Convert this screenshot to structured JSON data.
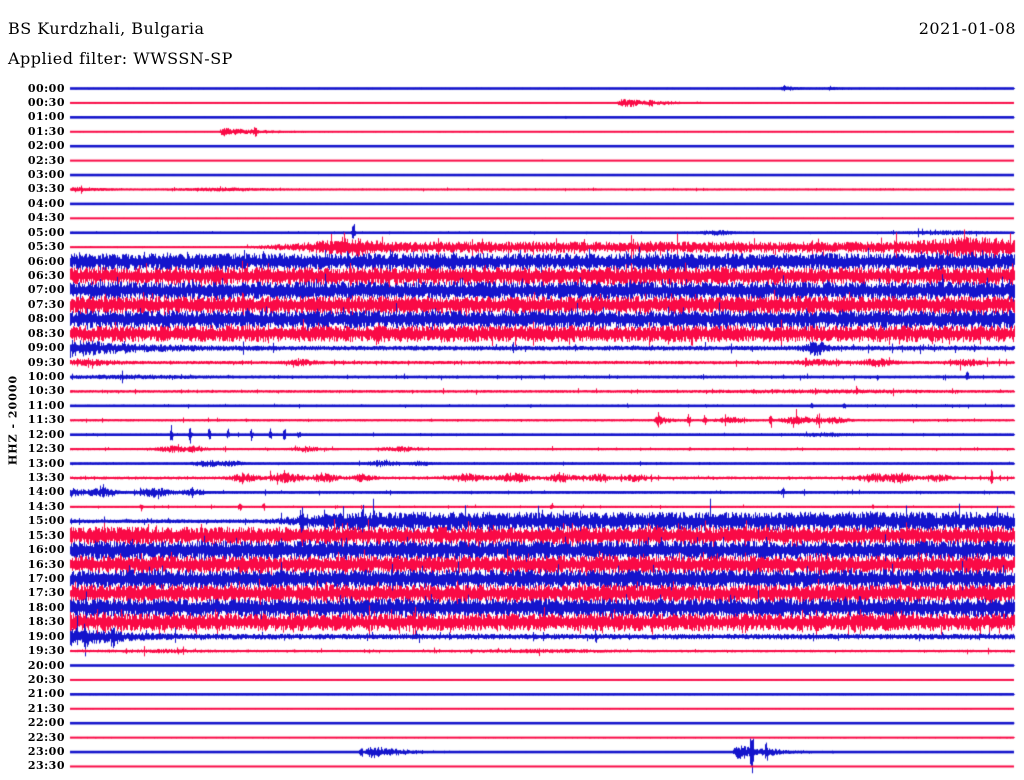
{
  "header": {
    "station": "BS Kurdzhali, Bulgaria",
    "filter": "Applied filter: WWSSN-SP",
    "date": "2021-01-08"
  },
  "axis": {
    "y_label": "HHZ - 20000",
    "minutes_per_row": 30,
    "first_row": "00:00",
    "last_row": "23:30"
  },
  "colors": {
    "blue": "#1414CC",
    "red": "#FA0A46",
    "text": "#000000",
    "background": "#FFFFFF"
  },
  "chart_data": {
    "type": "line",
    "subtype": "helicorder-day-plot",
    "x_range_per_row_minutes": [
      0,
      30
    ],
    "rows": [
      {
        "label": "00:00",
        "color": "blue",
        "base": 0.7,
        "sparse": true,
        "spiky": false,
        "ev": [
          {
            "type": "q",
            "t": 0.755,
            "amp": 3,
            "d": 0.02
          },
          {
            "type": "q",
            "t": 0.805,
            "amp": 2,
            "d": 0.012
          }
        ]
      },
      {
        "label": "00:30",
        "color": "red",
        "base": 0.5,
        "sparse": true,
        "spiky": false,
        "ev": [
          {
            "type": "q",
            "t": 0.582,
            "amp": 4.5,
            "d": 0.05
          },
          {
            "type": "spike",
            "t": 0.615,
            "amp": 5
          }
        ]
      },
      {
        "label": "01:00",
        "color": "blue",
        "base": 0.45,
        "sparse": true,
        "spiky": false,
        "ev": [
          {
            "type": "spike",
            "t": 0.525,
            "amp": 1.5
          }
        ]
      },
      {
        "label": "01:30",
        "color": "red",
        "base": 0.5,
        "sparse": true,
        "spiky": false,
        "ev": [
          {
            "type": "q",
            "t": 0.161,
            "amp": 4.5,
            "d": 0.04
          },
          {
            "type": "spike",
            "t": 0.196,
            "amp": 4.5
          }
        ]
      },
      {
        "label": "02:00",
        "color": "blue",
        "base": 0.3,
        "sparse": true,
        "spiky": false,
        "ev": []
      },
      {
        "label": "02:30",
        "color": "red",
        "base": 0.4,
        "sparse": true,
        "spiky": false,
        "ev": [
          {
            "type": "spike",
            "t": 0.5,
            "amp": 1
          }
        ]
      },
      {
        "label": "03:00",
        "color": "blue",
        "base": 0.5,
        "sparse": true,
        "spiky": false,
        "ev": []
      },
      {
        "label": "03:30",
        "color": "red",
        "base": 0.8,
        "sparse": false,
        "spiky": true,
        "ev": [
          {
            "type": "q",
            "t": 0.004,
            "amp": 2.8,
            "d": 0.02
          },
          {
            "type": "patch",
            "t": 0.165,
            "amp": 1.3,
            "w": 0.035
          }
        ]
      },
      {
        "label": "04:00",
        "color": "blue",
        "base": 0.4,
        "sparse": true,
        "spiky": false,
        "ev": []
      },
      {
        "label": "04:30",
        "color": "red",
        "base": 0.45,
        "sparse": true,
        "spiky": false,
        "ev": [
          {
            "type": "spike",
            "t": 0.82,
            "amp": 1
          },
          {
            "type": "spike",
            "t": 0.86,
            "amp": 1
          }
        ]
      },
      {
        "label": "05:00",
        "color": "blue",
        "base": 0.9,
        "sparse": false,
        "spiky": true,
        "ev": [
          {
            "type": "spike",
            "t": 0.3,
            "amp": 13
          },
          {
            "type": "patch",
            "t": 0.685,
            "amp": 2.2,
            "w": 0.012
          },
          {
            "type": "patch",
            "t": 0.93,
            "amp": 1.5,
            "w": 0.03
          }
        ]
      },
      {
        "label": "05:30",
        "color": "red",
        "base": 0.6,
        "sparse": false,
        "spiky": true,
        "ev": [
          {
            "type": "step",
            "t": 0.16,
            "amp": 5,
            "r": 0.12
          },
          {
            "type": "patch",
            "t": 0.295,
            "amp": 3.5,
            "w": 0.02
          },
          {
            "type": "patch",
            "t": 0.955,
            "amp": 5,
            "w": 0.035
          }
        ]
      },
      {
        "label": "06:00",
        "color": "blue",
        "base": 8.5,
        "sparse": false,
        "spiky": true,
        "ev": []
      },
      {
        "label": "06:30",
        "color": "red",
        "base": 9,
        "sparse": false,
        "spiky": true,
        "ev": []
      },
      {
        "label": "07:00",
        "color": "blue",
        "base": 9,
        "sparse": false,
        "spiky": true,
        "ev": []
      },
      {
        "label": "07:30",
        "color": "red",
        "base": 9,
        "sparse": false,
        "spiky": true,
        "ev": []
      },
      {
        "label": "08:00",
        "color": "blue",
        "base": 9,
        "sparse": false,
        "spiky": true,
        "ev": []
      },
      {
        "label": "08:30",
        "color": "red",
        "base": 8.5,
        "sparse": false,
        "spiky": true,
        "ev": []
      },
      {
        "label": "09:00",
        "color": "blue",
        "base": 2.4,
        "sparse": false,
        "spiky": true,
        "ev": [
          {
            "type": "fade",
            "t": 0,
            "amp": 7.5,
            "d": 0.06
          },
          {
            "type": "patch",
            "t": 0.79,
            "amp": 6,
            "w": 0.008
          }
        ]
      },
      {
        "label": "09:30",
        "color": "red",
        "base": 1.7,
        "sparse": false,
        "spiky": true,
        "ev": [
          {
            "type": "patch",
            "t": 0.02,
            "amp": 2,
            "w": 0.02
          },
          {
            "type": "patch",
            "t": 0.245,
            "amp": 2,
            "w": 0.01
          },
          {
            "type": "patch",
            "t": 0.79,
            "amp": 2,
            "w": 0.015
          },
          {
            "type": "patch",
            "t": 0.855,
            "amp": 3,
            "w": 0.012
          },
          {
            "type": "patch",
            "t": 0.95,
            "amp": 2.5,
            "w": 0.01
          }
        ]
      },
      {
        "label": "10:00",
        "color": "blue",
        "base": 1.4,
        "sparse": false,
        "spiky": true,
        "ev": [
          {
            "type": "patch",
            "t": 0.06,
            "amp": 1.2,
            "w": 0.05
          },
          {
            "type": "spike",
            "t": 0.95,
            "amp": 6
          }
        ]
      },
      {
        "label": "10:30",
        "color": "red",
        "base": 1.3,
        "sparse": false,
        "spiky": true,
        "ev": [
          {
            "type": "patch",
            "t": 0.8,
            "amp": 1,
            "w": 0.08
          }
        ]
      },
      {
        "label": "11:00",
        "color": "blue",
        "base": 1.1,
        "sparse": false,
        "spiky": true,
        "ev": [
          {
            "type": "spike",
            "t": 0.785,
            "amp": 2.5
          },
          {
            "type": "spike",
            "t": 0.82,
            "amp": 2.5
          }
        ]
      },
      {
        "label": "11:30",
        "color": "red",
        "base": 1.1,
        "sparse": false,
        "spiky": true,
        "ev": [
          {
            "type": "q",
            "t": 0.622,
            "amp": 5,
            "d": 0.01
          },
          {
            "type": "spike",
            "t": 0.655,
            "amp": 8
          },
          {
            "type": "spike",
            "t": 0.672,
            "amp": 7
          },
          {
            "type": "patch",
            "t": 0.7,
            "amp": 3,
            "w": 0.01
          },
          {
            "type": "spike",
            "t": 0.742,
            "amp": 6
          },
          {
            "type": "patch",
            "t": 0.77,
            "amp": 3.5,
            "w": 0.012
          },
          {
            "type": "spike",
            "t": 0.792,
            "amp": 7
          },
          {
            "type": "patch",
            "t": 0.81,
            "amp": 2.5,
            "w": 0.01
          }
        ]
      },
      {
        "label": "12:00",
        "color": "blue",
        "base": 1,
        "sparse": false,
        "spiky": true,
        "ev": [
          {
            "type": "spike",
            "t": 0.107,
            "amp": 9
          },
          {
            "type": "spike",
            "t": 0.127,
            "amp": 9
          },
          {
            "type": "spike",
            "t": 0.147,
            "amp": 7
          },
          {
            "type": "spike",
            "t": 0.167,
            "amp": 6
          },
          {
            "type": "spike",
            "t": 0.192,
            "amp": 8
          },
          {
            "type": "spike",
            "t": 0.212,
            "amp": 6
          },
          {
            "type": "spike",
            "t": 0.227,
            "amp": 7
          },
          {
            "type": "spike",
            "t": 0.242,
            "amp": 5
          },
          {
            "type": "patch",
            "t": 0.8,
            "amp": 1.5,
            "w": 0.02
          }
        ]
      },
      {
        "label": "12:30",
        "color": "red",
        "base": 1.2,
        "sparse": false,
        "spiky": true,
        "ev": [
          {
            "type": "patch",
            "t": 0.108,
            "amp": 2.5,
            "w": 0.01
          },
          {
            "type": "patch",
            "t": 0.133,
            "amp": 2.5,
            "w": 0.008
          },
          {
            "type": "patch",
            "t": 0.25,
            "amp": 2,
            "w": 0.01
          },
          {
            "type": "patch",
            "t": 0.35,
            "amp": 2,
            "w": 0.012
          }
        ]
      },
      {
        "label": "13:00",
        "color": "blue",
        "base": 1,
        "sparse": false,
        "spiky": true,
        "ev": [
          {
            "type": "patch",
            "t": 0.145,
            "amp": 3,
            "w": 0.01
          },
          {
            "type": "patch",
            "t": 0.172,
            "amp": 2.5,
            "w": 0.008
          },
          {
            "type": "patch",
            "t": 0.33,
            "amp": 2.8,
            "w": 0.01
          },
          {
            "type": "patch",
            "t": 0.37,
            "amp": 2.2,
            "w": 0.008
          }
        ]
      },
      {
        "label": "13:30",
        "color": "red",
        "base": 1.5,
        "sparse": false,
        "spiky": true,
        "ev": [
          {
            "type": "patch",
            "t": 0.185,
            "amp": 3.5,
            "w": 0.01
          },
          {
            "type": "patch",
            "t": 0.23,
            "amp": 4,
            "w": 0.012
          },
          {
            "type": "patch",
            "t": 0.27,
            "amp": 3.5,
            "w": 0.01
          },
          {
            "type": "patch",
            "t": 0.31,
            "amp": 3,
            "w": 0.008
          },
          {
            "type": "patch",
            "t": 0.42,
            "amp": 3.5,
            "w": 0.012
          },
          {
            "type": "patch",
            "t": 0.47,
            "amp": 4,
            "w": 0.012
          },
          {
            "type": "patch",
            "t": 0.52,
            "amp": 3.5,
            "w": 0.01
          },
          {
            "type": "patch",
            "t": 0.56,
            "amp": 3,
            "w": 0.008
          },
          {
            "type": "patch",
            "t": 0.6,
            "amp": 3,
            "w": 0.008
          },
          {
            "type": "patch",
            "t": 0.85,
            "amp": 3.5,
            "w": 0.012
          },
          {
            "type": "patch",
            "t": 0.88,
            "amp": 4,
            "w": 0.01
          },
          {
            "type": "patch",
            "t": 0.92,
            "amp": 3,
            "w": 0.008
          },
          {
            "type": "spike",
            "t": 0.976,
            "amp": 10
          }
        ]
      },
      {
        "label": "14:00",
        "color": "blue",
        "base": 1.3,
        "sparse": false,
        "spiky": true,
        "ev": [
          {
            "type": "q",
            "t": 0,
            "amp": 4,
            "d": 0.015
          },
          {
            "type": "patch",
            "t": 0.035,
            "amp": 3.5,
            "w": 0.01
          },
          {
            "type": "patch",
            "t": 0.09,
            "amp": 4,
            "w": 0.012
          },
          {
            "type": "patch",
            "t": 0.13,
            "amp": 2.5,
            "w": 0.008
          },
          {
            "type": "spike",
            "t": 0.755,
            "amp": 5
          }
        ]
      },
      {
        "label": "14:30",
        "color": "red",
        "base": 0.9,
        "sparse": false,
        "spiky": true,
        "ev": [
          {
            "type": "spike",
            "t": 0.075,
            "amp": 4
          },
          {
            "type": "spike",
            "t": 0.18,
            "amp": 5
          },
          {
            "type": "spike",
            "t": 0.205,
            "amp": 4
          },
          {
            "type": "spike",
            "t": 0.51,
            "amp": 4
          }
        ]
      },
      {
        "label": "15:00",
        "color": "blue",
        "base": 2,
        "sparse": false,
        "spiky": true,
        "ev": [
          {
            "type": "step",
            "t": 0.19,
            "amp": 7.5,
            "r": 0.12
          },
          {
            "type": "spike",
            "t": 0.245,
            "amp": 15
          },
          {
            "type": "spike",
            "t": 0.27,
            "amp": 13
          },
          {
            "type": "spike",
            "t": 0.31,
            "amp": 10
          }
        ]
      },
      {
        "label": "15:30",
        "color": "red",
        "base": 9,
        "sparse": false,
        "spiky": true,
        "ev": []
      },
      {
        "label": "16:00",
        "color": "blue",
        "base": 9.5,
        "sparse": false,
        "spiky": true,
        "ev": []
      },
      {
        "label": "16:30",
        "color": "red",
        "base": 9,
        "sparse": false,
        "spiky": true,
        "ev": []
      },
      {
        "label": "17:00",
        "color": "blue",
        "base": 9.5,
        "sparse": false,
        "spiky": true,
        "ev": []
      },
      {
        "label": "17:30",
        "color": "red",
        "base": 9,
        "sparse": false,
        "spiky": true,
        "ev": []
      },
      {
        "label": "18:00",
        "color": "blue",
        "base": 9.5,
        "sparse": false,
        "spiky": true,
        "ev": []
      },
      {
        "label": "18:30",
        "color": "red",
        "base": 9,
        "sparse": false,
        "spiky": true,
        "ev": []
      },
      {
        "label": "19:00",
        "color": "blue",
        "base": 2.8,
        "sparse": false,
        "spiky": true,
        "ev": [
          {
            "type": "fade",
            "t": 0,
            "amp": 8,
            "d": 0.045
          },
          {
            "type": "spike",
            "t": 0.016,
            "amp": 15
          },
          {
            "type": "spike",
            "t": 0.045,
            "amp": 13
          }
        ]
      },
      {
        "label": "19:30",
        "color": "red",
        "base": 1.3,
        "sparse": false,
        "spiky": true,
        "ev": [
          {
            "type": "patch",
            "t": 0.1,
            "amp": 1,
            "w": 0.03
          },
          {
            "type": "patch",
            "t": 0.5,
            "amp": 1,
            "w": 0.05
          }
        ]
      },
      {
        "label": "20:00",
        "color": "blue",
        "base": 0.55,
        "sparse": true,
        "spiky": false,
        "ev": []
      },
      {
        "label": "20:30",
        "color": "red",
        "base": 0.4,
        "sparse": true,
        "spiky": false,
        "ev": []
      },
      {
        "label": "21:00",
        "color": "blue",
        "base": 0.85,
        "sparse": false,
        "spiky": false,
        "ev": []
      },
      {
        "label": "21:30",
        "color": "red",
        "base": 0.5,
        "sparse": true,
        "spiky": false,
        "ev": []
      },
      {
        "label": "22:00",
        "color": "blue",
        "base": 0.5,
        "sparse": false,
        "spiky": false,
        "ev": []
      },
      {
        "label": "22:30",
        "color": "red",
        "base": 0.7,
        "sparse": true,
        "spiky": false,
        "ev": []
      },
      {
        "label": "23:00",
        "color": "blue",
        "base": 0.7,
        "sparse": true,
        "spiky": false,
        "ev": [
          {
            "type": "spike",
            "t": 0.308,
            "amp": 9
          },
          {
            "type": "q",
            "t": 0.315,
            "amp": 7,
            "d": 0.035
          },
          {
            "type": "q",
            "t": 0.705,
            "amp": 8,
            "d": 0.04
          },
          {
            "type": "spike",
            "t": 0.722,
            "amp": 26
          },
          {
            "type": "spike",
            "t": 0.737,
            "amp": 10
          }
        ]
      },
      {
        "label": "23:30",
        "color": "red",
        "base": 0.5,
        "sparse": true,
        "spiky": false,
        "ev": []
      }
    ]
  }
}
